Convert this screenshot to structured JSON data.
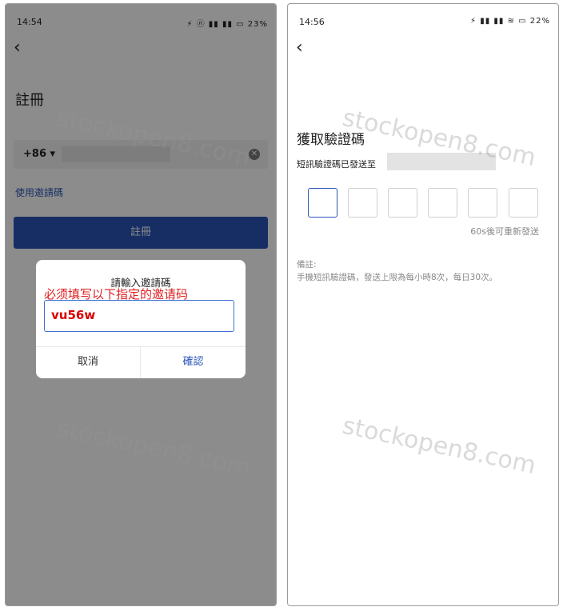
{
  "left": {
    "status": {
      "time": "14:54",
      "icons": "⚡ ⓝ ▮▮ ▮▮ ▭ 23%"
    },
    "title": "註冊",
    "country_code": "+86 ▾",
    "invite_link": "使用邀請碼",
    "register_button": "註冊",
    "dialog": {
      "title": "請輸入邀請碼",
      "note": "必须填写以下指定的邀请码",
      "input_value": "vu56w",
      "cancel": "取消",
      "confirm": "確認"
    }
  },
  "right": {
    "status": {
      "time": "14:56",
      "icons": "⚡ ▮▮ ▮▮ ≋ ▭ 22%"
    },
    "title": "獲取驗證碼",
    "subtitle": "短訊驗證碼已發送至",
    "code_boxes": 6,
    "resend": "60s後可重新發送",
    "note_label": "備註:",
    "note_text": "手機短訊驗證碼，發送上限為每小時8次，每日30次。"
  },
  "watermark": "stockopen8.com"
}
